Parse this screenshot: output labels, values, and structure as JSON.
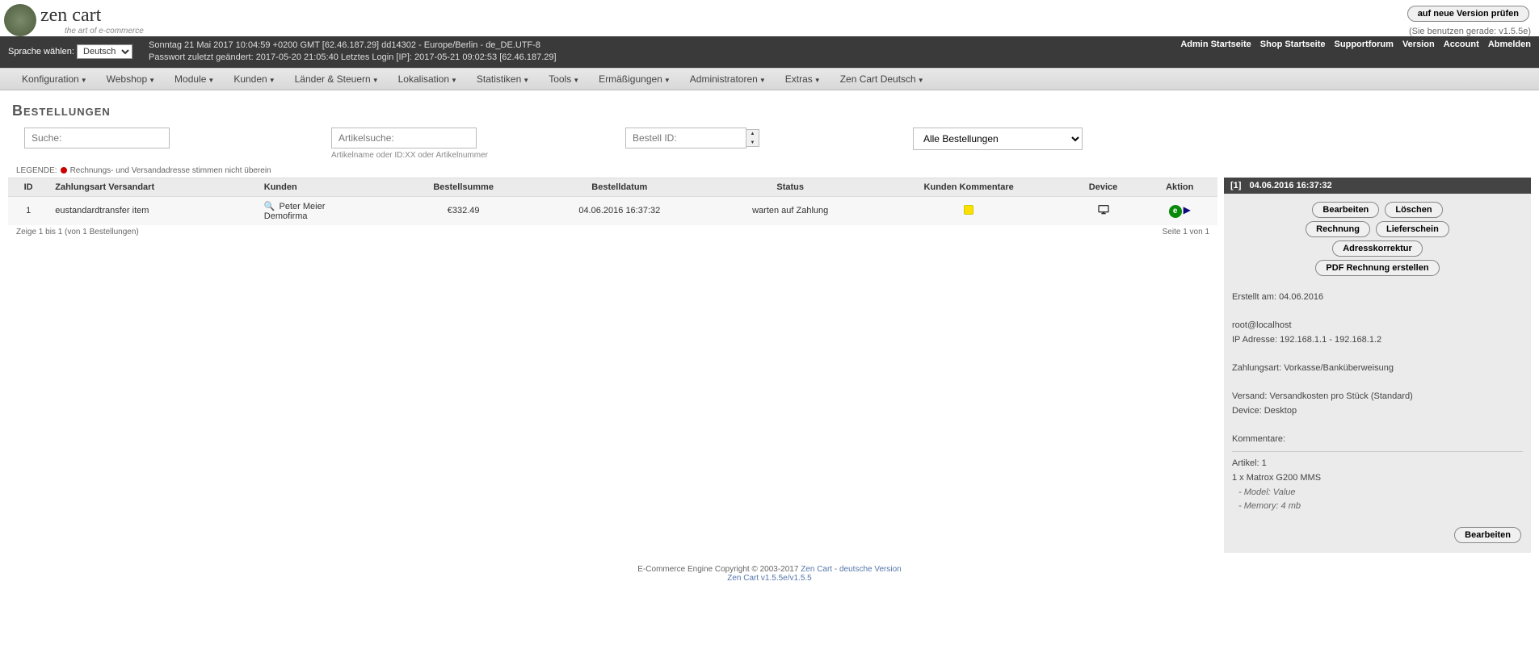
{
  "brand": {
    "name": "zen cart",
    "slogan": "the art of e-commerce"
  },
  "version_check_btn": "auf neue Version prüfen",
  "version_text": "(Sie benutzen gerade: v1.5.5e)",
  "lang_label": "Sprache wählen:",
  "lang_value": "Deutsch",
  "server_info_l1": "Sonntag 21 Mai 2017 10:04:59 +0200 GMT [62.46.187.29]  dd14302 - Europe/Berlin - de_DE.UTF-8",
  "server_info_l2": "Passwort zuletzt geändert: 2017-05-20 21:05:40   Letztes Login [IP]: 2017-05-21 09:02:53 [62.46.187.29]",
  "top_links": [
    "Admin Startseite",
    "Shop Startseite",
    "Supportforum",
    "Version",
    "Account",
    "Abmelden"
  ],
  "menu": [
    "Konfiguration",
    "Webshop",
    "Module",
    "Kunden",
    "Länder & Steuern",
    "Lokalisation",
    "Statistiken",
    "Tools",
    "Ermäßigungen",
    "Administratoren",
    "Extras",
    "Zen Cart Deutsch"
  ],
  "page_title": "Bestellungen",
  "search": {
    "ph": "Suche:"
  },
  "article_search": {
    "ph": "Artikelsuche:",
    "hint": "Artikelname oder ID:XX oder Artikelnummer"
  },
  "order_id": {
    "ph": "Bestell ID:"
  },
  "status_filter": "Alle Bestellungen",
  "legend_label": "LEGENDE:",
  "legend_text": "Rechnungs- und Versandadresse stimmen nicht überein",
  "cols": {
    "id": "ID",
    "pay": "Zahlungsart Versandart",
    "cust": "Kunden",
    "total": "Bestellsumme",
    "date": "Bestelldatum",
    "status": "Status",
    "comm": "Kunden Kommentare",
    "device": "Device",
    "action": "Aktion"
  },
  "row": {
    "id": "1",
    "pay": "eustandardtransfer item",
    "cust_l1": "Peter Meier",
    "cust_l2": "Demofirma",
    "total": "€332.49",
    "date": "04.06.2016 16:37:32",
    "status": "warten auf Zahlung"
  },
  "pager_left": "Zeige 1 bis 1 (von 1 Bestellungen)",
  "pager_right": "Seite 1 von 1",
  "side": {
    "hdr_id": "[1]",
    "hdr_date": "04.06.2016 16:37:32",
    "btns": {
      "edit": "Bearbeiten",
      "del": "Löschen",
      "inv": "Rechnung",
      "ship": "Lieferschein",
      "addr": "Adresskorrektur",
      "pdf": "PDF Rechnung erstellen"
    },
    "created": "Erstellt am: 04.06.2016",
    "email": "root@localhost",
    "ip": "IP Adresse: 192.168.1.1 - 192.168.1.2",
    "pay": "Zahlungsart: Vorkasse/Banküberweisung",
    "ship": "Versand: Versandkosten pro Stück (Standard)",
    "device": "Device: Desktop",
    "comments": "Kommentare:",
    "articles": "Artikel: 1",
    "art_line": "1 x Matrox G200 MMS",
    "attr1": "- Model: Value",
    "attr2": "- Memory: 4 mb",
    "foot_btn": "Bearbeiten"
  },
  "footer": {
    "l1a": "E-Commerce Engine Copyright © 2003-2017 ",
    "l1b": "Zen Cart",
    "l1c": " - ",
    "l1d": "deutsche Version",
    "l2": "Zen Cart v1.5.5e/v1.5.5"
  }
}
